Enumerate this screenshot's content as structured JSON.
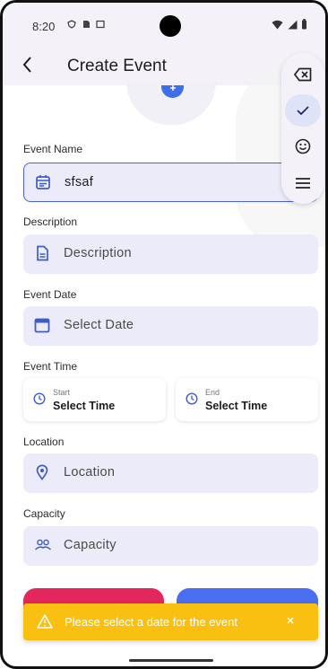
{
  "status_bar": {
    "time": "8:20"
  },
  "app_bar": {
    "back_icon": "back-arrow-icon",
    "title": "Create Event"
  },
  "form": {
    "event_name": {
      "label": "Event Name",
      "value": "sfsaf",
      "icon": "calendar-list-icon"
    },
    "description": {
      "label": "Description",
      "placeholder": "Description",
      "icon": "document-icon"
    },
    "event_date": {
      "label": "Event Date",
      "placeholder": "Select Date",
      "icon": "calendar-icon"
    },
    "event_time": {
      "label": "Event Time",
      "start": {
        "caption": "Start",
        "value": "Select Time",
        "icon": "clock-icon"
      },
      "end": {
        "caption": "End",
        "value": "Select Time",
        "icon": "clock-icon"
      }
    },
    "location": {
      "label": "Location",
      "placeholder": "Location",
      "icon": "location-pin-icon"
    },
    "capacity": {
      "label": "Capacity",
      "placeholder": "Capacity",
      "icon": "people-icon"
    }
  },
  "keyboard_toolbar": {
    "buttons": [
      "backspace-icon",
      "check-icon",
      "emoji-icon",
      "menu-icon"
    ]
  },
  "snackbar": {
    "message": "Please select a date for the event",
    "icon": "warning-icon",
    "close_icon": "close-icon",
    "color": "#f9c012"
  },
  "colors": {
    "accent": "#3d5cc8",
    "field_bg": "#ecebfa",
    "cancel_button": "#e3275c",
    "submit_button": "#4a6ef0"
  }
}
